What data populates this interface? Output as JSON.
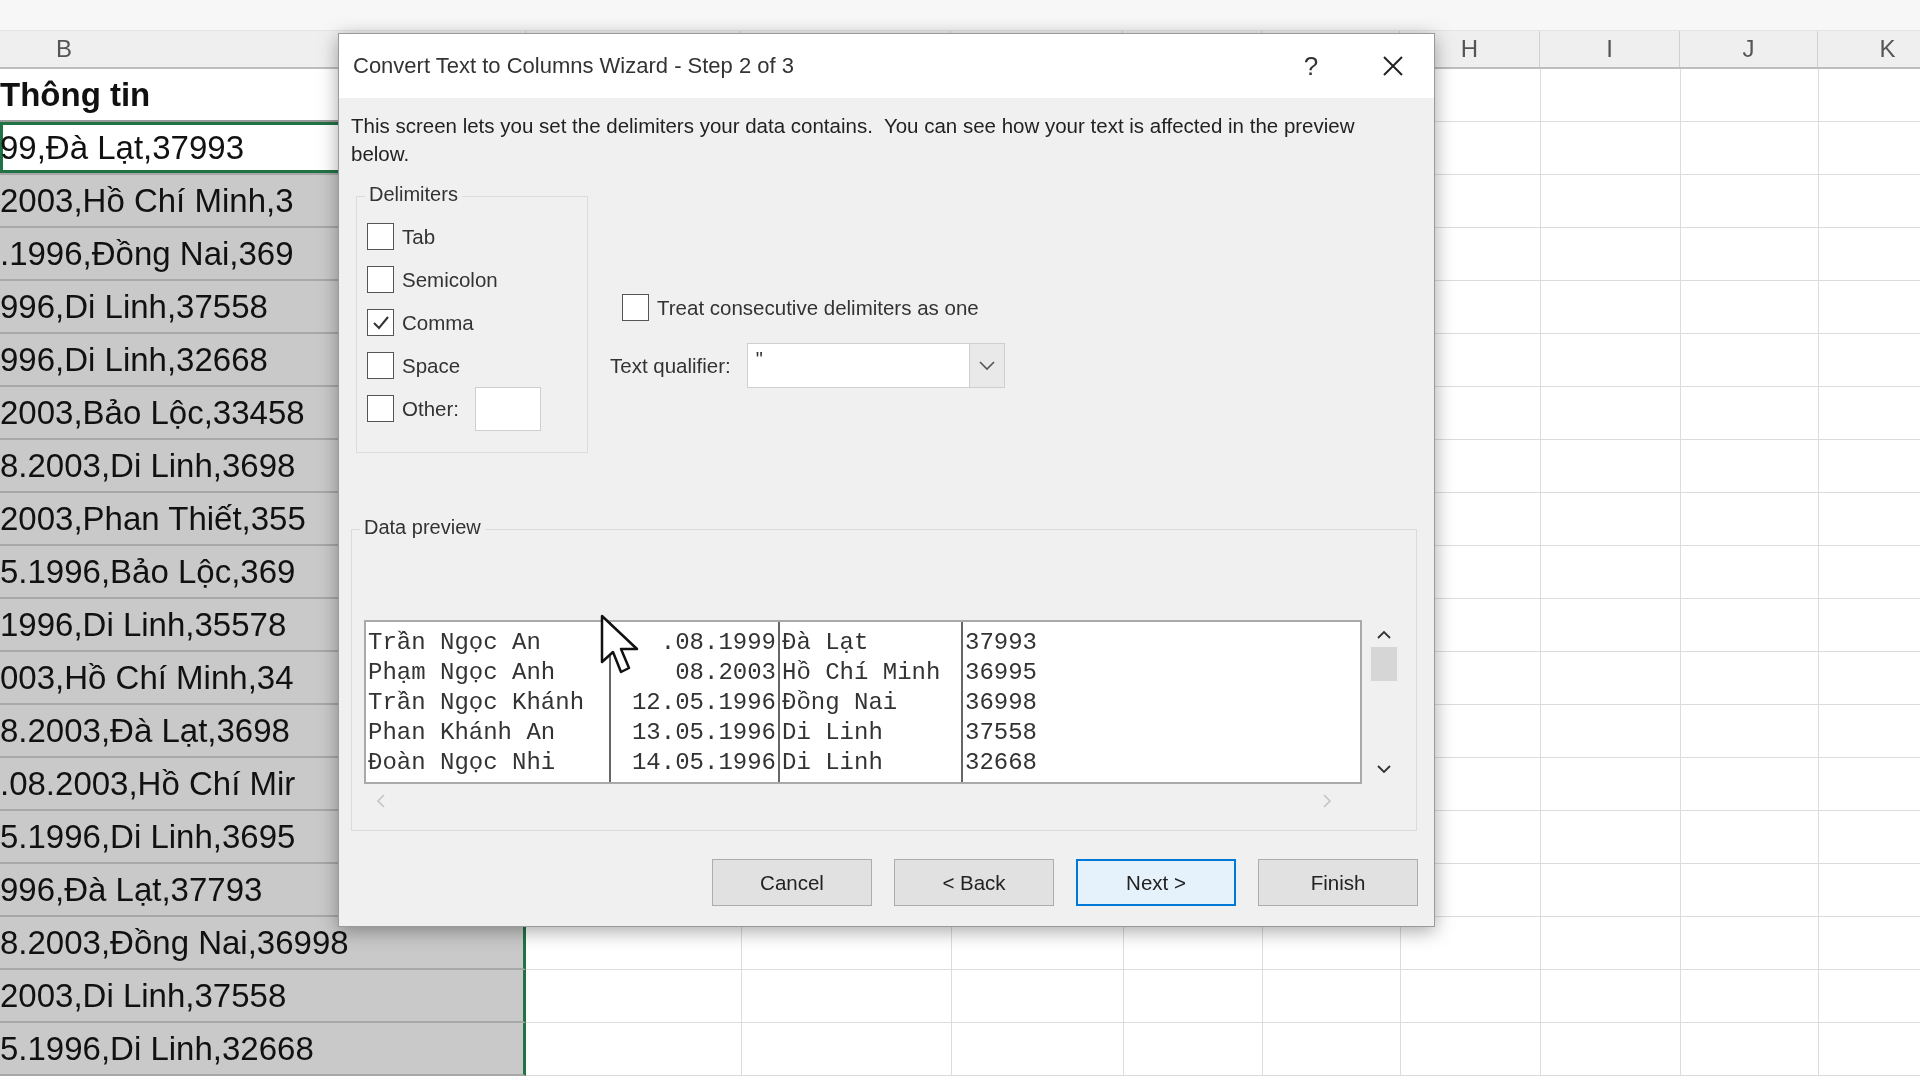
{
  "sheet": {
    "column_headers": [
      "B",
      "H",
      "I",
      "J",
      "K"
    ],
    "rows": [
      {
        "text": "Thông tin",
        "kind": "header",
        "selected": false,
        "active": false
      },
      {
        "text": "99,Đà Lạt,37993",
        "kind": "data",
        "selected": true,
        "active": true
      },
      {
        "text": "2003,Hồ Chí Minh,3",
        "kind": "data",
        "selected": true,
        "active": false
      },
      {
        "text": ".1996,Đồng Nai,369",
        "kind": "data",
        "selected": true,
        "active": false
      },
      {
        "text": "996,Di Linh,37558",
        "kind": "data",
        "selected": true,
        "active": false
      },
      {
        "text": "996,Di Linh,32668",
        "kind": "data",
        "selected": true,
        "active": false
      },
      {
        "text": "2003,Bảo Lộc,33458",
        "kind": "data",
        "selected": true,
        "active": false
      },
      {
        "text": "8.2003,Di Linh,3698",
        "kind": "data",
        "selected": true,
        "active": false
      },
      {
        "text": "2003,Phan Thiết,355",
        "kind": "data",
        "selected": true,
        "active": false
      },
      {
        "text": "5.1996,Bảo Lộc,369",
        "kind": "data",
        "selected": true,
        "active": false
      },
      {
        "text": "1996,Di Linh,35578",
        "kind": "data",
        "selected": true,
        "active": false
      },
      {
        "text": "003,Hồ Chí Minh,34",
        "kind": "data",
        "selected": true,
        "active": false
      },
      {
        "text": "8.2003,Đà Lạt,3698",
        "kind": "data",
        "selected": true,
        "active": false
      },
      {
        "text": ".08.2003,Hồ Chí Mir",
        "kind": "data",
        "selected": true,
        "active": false
      },
      {
        "text": "5.1996,Di Linh,3695",
        "kind": "data",
        "selected": true,
        "active": false
      },
      {
        "text": "996,Đà Lạt,37793",
        "kind": "data",
        "selected": true,
        "active": false
      },
      {
        "text": "8.2003,Đồng Nai,36998",
        "kind": "data",
        "selected": true,
        "active": false
      },
      {
        "text": "2003,Di Linh,37558",
        "kind": "data",
        "selected": true,
        "active": false
      },
      {
        "text": "5.1996,Di Linh,32668",
        "kind": "data",
        "selected": true,
        "active": false
      }
    ]
  },
  "dialog": {
    "title": "Convert Text to Columns Wizard - Step 2 of 3",
    "help": "?",
    "description": "This screen lets you set the delimiters your data contains.  You can see how your text is affected in the preview below.",
    "delimiters": {
      "label": "Delimiters",
      "items": [
        {
          "label": "Tab",
          "checked": false,
          "kind": "checkbox"
        },
        {
          "label": "Semicolon",
          "checked": false,
          "kind": "checkbox"
        },
        {
          "label": "Comma",
          "checked": true,
          "kind": "checkbox"
        },
        {
          "label": "Space",
          "checked": false,
          "kind": "checkbox"
        },
        {
          "label": "Other:",
          "checked": false,
          "kind": "checkbox_with_field"
        }
      ]
    },
    "consecutive": {
      "label": "Treat consecutive delimiters as one",
      "checked": false
    },
    "text_qualifier": {
      "label": "Text qualifier:",
      "value": "\""
    },
    "preview": {
      "label": "Data preview",
      "rows": [
        [
          "Trần Ngọc An",
          ".08.1999",
          "Đà Lạt",
          "37993"
        ],
        [
          "Phạm Ngọc Anh",
          "08.2003",
          "Hồ Chí Minh",
          "36995"
        ],
        [
          "Trần Ngọc Khánh",
          "12.05.1996",
          "Đồng Nai",
          "36998"
        ],
        [
          "Phan Khánh An",
          "13.05.1996",
          "Di Linh",
          "37558"
        ],
        [
          "Đoàn Ngọc Nhi",
          "14.05.1996",
          "Di Linh",
          "32668"
        ]
      ]
    },
    "buttons": [
      {
        "label": "Cancel",
        "default": false
      },
      {
        "label": "< Back",
        "default": false
      },
      {
        "label": "Next >",
        "default": true
      },
      {
        "label": "Finish",
        "default": false
      }
    ]
  }
}
